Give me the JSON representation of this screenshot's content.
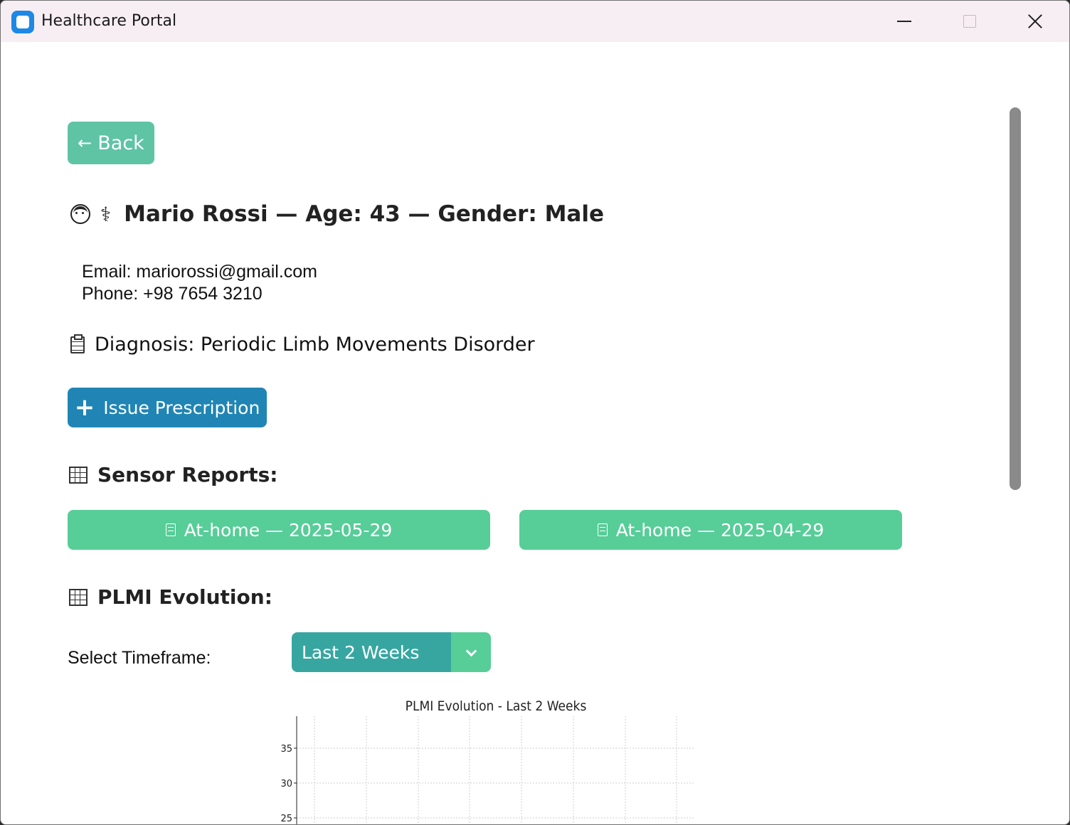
{
  "window": {
    "title": "Healthcare Portal"
  },
  "back_label": "Back",
  "patient": {
    "header": "Mario Rossi — Age: 43 — Gender: Male",
    "email": "Email: mariorossi@gmail.com",
    "phone": "Phone: +98 7654 3210",
    "diagnosis": "Diagnosis: Periodic Limb Movements Disorder"
  },
  "issue_prescription_label": "Issue Prescription",
  "sensor_reports": {
    "title": "Sensor Reports:",
    "reports": [
      {
        "label": "At-home — 2025-05-29"
      },
      {
        "label": "At-home — 2025-04-29"
      }
    ]
  },
  "plmi": {
    "title": "PLMI Evolution:",
    "timeframe_label": "Select Timeframe:",
    "timeframe_value": "Last 2 Weeks"
  },
  "chart_data": {
    "type": "line",
    "title": "PLMI Evolution - Last 2 Weeks",
    "xlabel": "",
    "ylabel": "",
    "yticks": [
      35,
      30,
      25
    ],
    "grid": true,
    "series": []
  },
  "colors": {
    "back_button": "#5fc4a4",
    "issue_button": "#2085b4",
    "report_button": "#57cd98",
    "select_bg": "#37a6a1"
  }
}
